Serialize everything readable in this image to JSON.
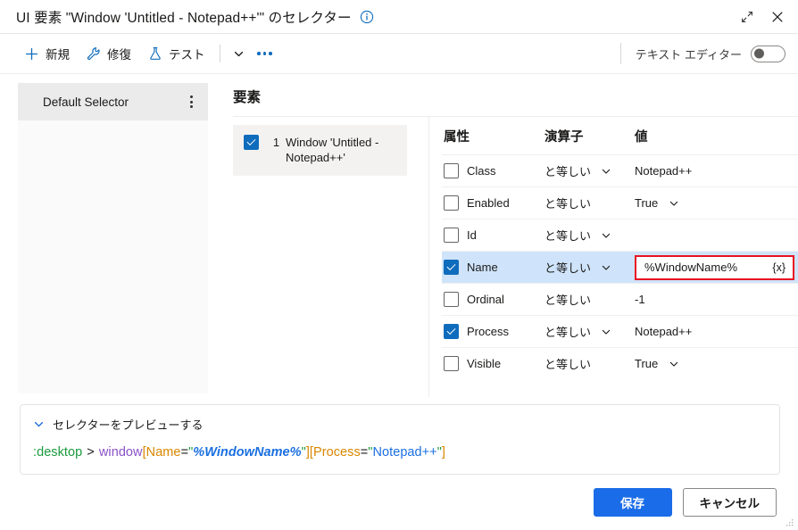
{
  "titlebar": {
    "title": "UI 要素 \"Window 'Untitled - Notepad++'\" のセレクター",
    "info_icon": "info-circle-icon",
    "expand_icon": "expand-diagonal-icon",
    "close_icon": "close-x-icon"
  },
  "toolbar": {
    "new_label": "新規",
    "new_icon": "plus-icon",
    "repair_label": "修復",
    "repair_icon": "wrench-icon",
    "test_label": "テスト",
    "test_icon": "flask-icon",
    "chevron_icon": "chevron-down-icon",
    "overflow_icon": "ellipsis-horizontal-icon",
    "text_editor_label": "テキスト エディター",
    "text_editor_state": "off"
  },
  "sidebar": {
    "items": [
      {
        "label": "Default Selector",
        "selected": true,
        "menu_icon": "vertical-ellipsis-icon"
      }
    ]
  },
  "main": {
    "elements_header": "要素",
    "tree": [
      {
        "index": "1",
        "label": "Window 'Untitled - Notepad++'",
        "checked": true,
        "selected": true
      }
    ],
    "attributes_table": {
      "columns": [
        "属性",
        "演算子",
        "値"
      ],
      "operator_default": "と等しい",
      "rows": [
        {
          "checked": false,
          "name": "Class",
          "operator": "と等しい",
          "op_dropdown": true,
          "value": "Notepad++",
          "value_dropdown": false,
          "editing": false,
          "selected": false
        },
        {
          "checked": false,
          "name": "Enabled",
          "operator": "と等しい",
          "op_dropdown": false,
          "value": "True",
          "value_dropdown": true,
          "editing": false,
          "selected": false
        },
        {
          "checked": false,
          "name": "Id",
          "operator": "と等しい",
          "op_dropdown": true,
          "value": "",
          "value_dropdown": false,
          "editing": false,
          "selected": false
        },
        {
          "checked": true,
          "name": "Name",
          "operator": "と等しい",
          "op_dropdown": true,
          "value": "%WindowName%",
          "value_dropdown": false,
          "editing": true,
          "selected": true,
          "variable_icon": "{x}"
        },
        {
          "checked": false,
          "name": "Ordinal",
          "operator": "と等しい",
          "op_dropdown": false,
          "value": "-1",
          "value_dropdown": false,
          "editing": false,
          "selected": false
        },
        {
          "checked": true,
          "name": "Process",
          "operator": "と等しい",
          "op_dropdown": true,
          "value": "Notepad++",
          "value_dropdown": false,
          "editing": false,
          "selected": false
        },
        {
          "checked": false,
          "name": "Visible",
          "operator": "と等しい",
          "op_dropdown": false,
          "value": "True",
          "value_dropdown": true,
          "editing": false,
          "selected": false
        }
      ]
    }
  },
  "preview": {
    "toggle_label": "セレクターをプレビューする",
    "toggle_icon": "chevron-down-icon",
    "expanded": true,
    "selector_tokens": [
      {
        "text": ":desktop",
        "cls": "tk-desktop"
      },
      {
        "text": " > ",
        "cls": "tk-gt"
      },
      {
        "text": "window",
        "cls": "tk-tag"
      },
      {
        "text": "[",
        "cls": "tk-brk"
      },
      {
        "text": "Name",
        "cls": "tk-key"
      },
      {
        "text": "=",
        "cls": "tk-eq"
      },
      {
        "text": "\"",
        "cls": "tk-quote"
      },
      {
        "text": "%WindowName%",
        "cls": "tk-var"
      },
      {
        "text": "\"",
        "cls": "tk-quote"
      },
      {
        "text": "]",
        "cls": "tk-brk"
      },
      {
        "text": "[",
        "cls": "tk-brk"
      },
      {
        "text": "Process",
        "cls": "tk-key"
      },
      {
        "text": "=",
        "cls": "tk-eq"
      },
      {
        "text": "\"",
        "cls": "tk-quote"
      },
      {
        "text": "Notepad++",
        "cls": "tk-str"
      },
      {
        "text": "\"",
        "cls": "tk-quote"
      },
      {
        "text": "]",
        "cls": "tk-brk"
      }
    ],
    "selector_plain": ":desktop > window[Name=\"%WindowName%\"][Process=\"Notepad++\"]"
  },
  "footer": {
    "save_label": "保存",
    "cancel_label": "キャンセル"
  },
  "colors": {
    "accent": "#0f6cbd",
    "primary_button": "#1a6ce8",
    "highlight_row": "#cfe4fa",
    "error_border": "#e81123",
    "token_green": "#1a9b3e",
    "token_purple": "#8a51c9",
    "token_orange": "#d98700",
    "token_blue": "#1a6fe0"
  }
}
